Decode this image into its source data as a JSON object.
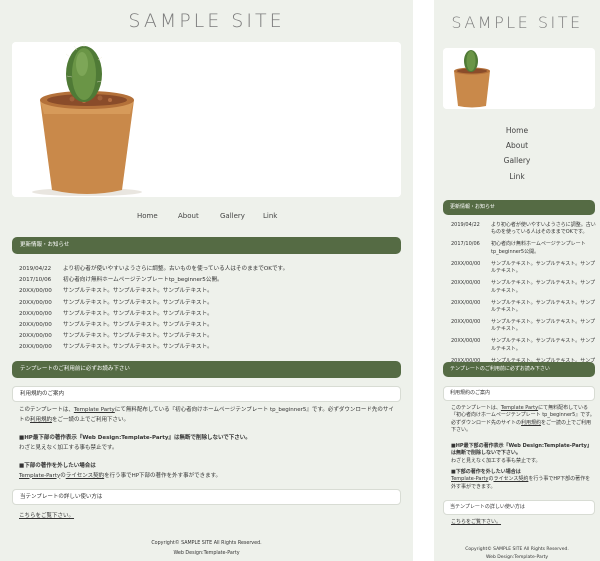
{
  "site": {
    "title": "SAMPLE SITE"
  },
  "nav": [
    "Home",
    "About",
    "Gallery",
    "Link"
  ],
  "news": {
    "heading": "更新情報・お知らせ",
    "items": [
      {
        "date": "2019/04/22",
        "text": "より初心者が使いやすいようさらに調整。古いものを使っている人はそのままでOKです。"
      },
      {
        "date": "2017/10/06",
        "text": "初心者向け無料ホームページテンプレートtp_beginner5公開。"
      },
      {
        "date": "20XX/00/00",
        "text": "サンプルテキスト。サンプルテキスト。サンプルテキスト。"
      },
      {
        "date": "20XX/00/00",
        "text": "サンプルテキスト。サンプルテキスト。サンプルテキスト。"
      },
      {
        "date": "20XX/00/00",
        "text": "サンプルテキスト。サンプルテキスト。サンプルテキスト。"
      },
      {
        "date": "20XX/00/00",
        "text": "サンプルテキスト。サンプルテキスト。サンプルテキスト。"
      },
      {
        "date": "20XX/00/00",
        "text": "サンプルテキスト。サンプルテキスト。サンプルテキスト。"
      },
      {
        "date": "20XX/00/00",
        "text": "サンプルテキスト。サンプルテキスト。サンプルテキスト。"
      }
    ]
  },
  "notice": {
    "heading": "テンプレートのご利用前に必ずお読み下さい",
    "box1": "利用規約のご案内",
    "p1_a": "このテンプレートは、",
    "p1_link": "Template Party",
    "p1_b": "にて無料配布している『初心者向けホームページテンプレート tp_beginner5』です。必ずダウンロード先のサイトの",
    "p1_link2": "利用規約",
    "p1_c": "をご一読の上でご利用下さい。",
    "h2": "■HP最下部の著作表示『Web Design:Template-Party』は無断で削除しないで下さい。",
    "p2": "わざと見えなく加工する事も禁止です。",
    "h3": "■下部の著作を外したい場合は",
    "p3_link": "Template-Party",
    "p3_a": "の",
    "p3_link2": "ライセンス契約",
    "p3_b": "を行う事でHP下部の著作を外す事ができます。",
    "box2": "当テンプレートの詳しい使い方は",
    "more_link": "こちらをご覧下さい。"
  },
  "footer": {
    "copyright": "Copyright© SAMPLE SITE All Rights Reserved.",
    "credit": "Web Design:Template-Party"
  },
  "colors": {
    "accent": "#556b44",
    "background": "#eef1eb"
  },
  "images": {
    "hero": "cactus-in-terracotta-pot"
  }
}
